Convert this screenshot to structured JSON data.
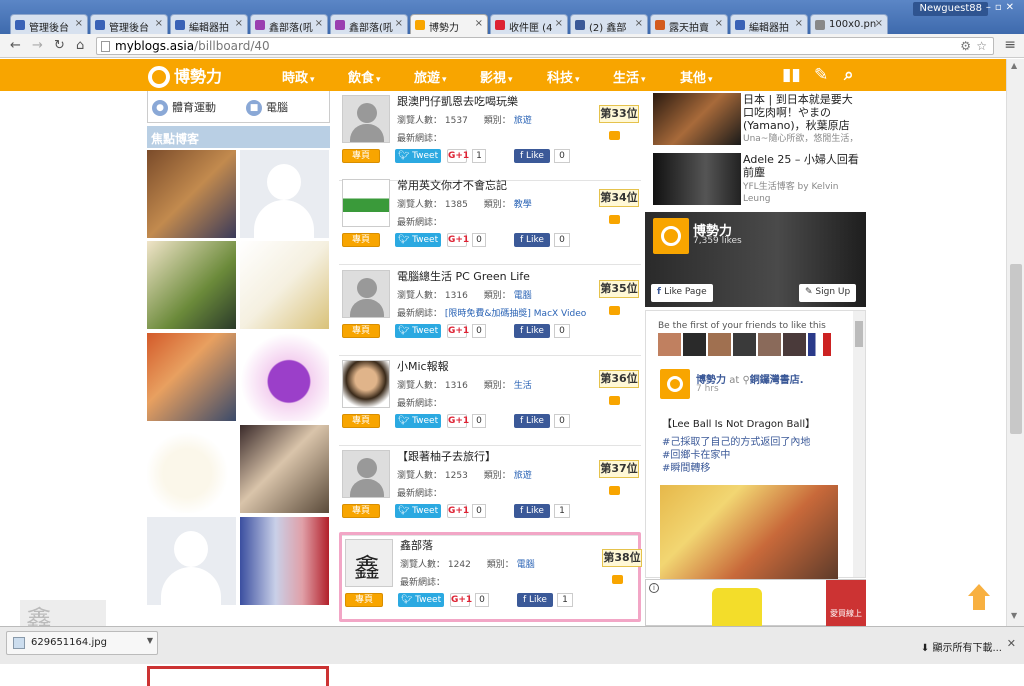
{
  "browser": {
    "tabs": [
      {
        "label": "管理後台",
        "icon_color": "#3a62b7"
      },
      {
        "label": "管理後台",
        "icon_color": "#3a62b7"
      },
      {
        "label": "編輯器拍",
        "icon_color": "#3a62b7"
      },
      {
        "label": "鑫部落(吼",
        "icon_color": "#9a3fb0"
      },
      {
        "label": "鑫部落(吼",
        "icon_color": "#9a3fb0"
      },
      {
        "label": "博勢力",
        "icon_color": "#f8a500"
      },
      {
        "label": "收件匣 (4",
        "icon_color": "#d23"
      },
      {
        "label": "(2) 鑫部",
        "icon_color": "#3b5998"
      },
      {
        "label": "露天拍賣",
        "icon_color": "#d35b1e"
      },
      {
        "label": "編輯器拍",
        "icon_color": "#3a62b7"
      },
      {
        "label": "100x0.pn",
        "icon_color": "#888"
      }
    ],
    "user": "Newguest88",
    "url_host": "myblogs.asia",
    "url_path": "/billboard/40"
  },
  "site": {
    "logo": "博勢力",
    "nav": [
      "時政",
      "飲食",
      "旅遊",
      "影視",
      "科技",
      "生活",
      "其他"
    ],
    "nav_icons": [
      "chart-icon",
      "pencil-icon",
      "search-icon"
    ]
  },
  "left": {
    "cats": [
      "體育運動",
      "電腦"
    ],
    "focus_title": "焦點博客"
  },
  "entries": [
    {
      "title": "跟澳門仔凱恩去吃喝玩樂",
      "views_label": "瀏覽人數：",
      "views": "1537",
      "cat_label": "類別：",
      "cat": "旅遊",
      "latest_label": "最新網誌：",
      "latest": "",
      "rank": "第33位",
      "home": "專頁",
      "tweet": "Tweet",
      "gplus": "G+1",
      "gcount": "1",
      "like": "Like",
      "fcount": "0",
      "thumb": "silhouette"
    },
    {
      "title": "常用英文你才不會忘記",
      "views_label": "瀏覽人數：",
      "views": "1385",
      "cat_label": "類別：",
      "cat": "教學",
      "latest_label": "最新網誌：",
      "latest": "",
      "rank": "第34位",
      "home": "專頁",
      "tweet": "Tweet",
      "gplus": "G+1",
      "gcount": "0",
      "like": "Like",
      "fcount": "0",
      "thumb": "english"
    },
    {
      "title": "電腦總生活 PC Green Life",
      "views_label": "瀏覽人數：",
      "views": "1316",
      "cat_label": "類別：",
      "cat": "電腦",
      "latest_label": "最新網誌：",
      "latest": "[限時免費&加碼抽獎] MacX Video",
      "rank": "第35位",
      "home": "專頁",
      "tweet": "Tweet",
      "gplus": "G+1",
      "gcount": "0",
      "like": "Like",
      "fcount": "0",
      "thumb": "silhouette"
    },
    {
      "title": "小Mic報報",
      "views_label": "瀏覽人數：",
      "views": "1316",
      "cat_label": "類別：",
      "cat": "生活",
      "latest_label": "最新網誌：",
      "latest": "",
      "rank": "第36位",
      "home": "專頁",
      "tweet": "Tweet",
      "gplus": "G+1",
      "gcount": "0",
      "like": "Like",
      "fcount": "0",
      "thumb": "photo"
    },
    {
      "title": "【跟著柚子去旅行】",
      "views_label": "瀏覽人數：",
      "views": "1253",
      "cat_label": "類別：",
      "cat": "旅遊",
      "latest_label": "最新網誌：",
      "latest": "",
      "rank": "第37位",
      "home": "專頁",
      "tweet": "Tweet",
      "gplus": "G+1",
      "gcount": "0",
      "like": "Like",
      "fcount": "1",
      "thumb": "silhouette"
    },
    {
      "title": "鑫部落",
      "views_label": "瀏覽人數：",
      "views": "1242",
      "cat_label": "類別：",
      "cat": "電腦",
      "latest_label": "最新網誌：",
      "latest": "",
      "rank": "第38位",
      "home": "專頁",
      "tweet": "Tweet",
      "gplus": "G+1",
      "gcount": "0",
      "like": "Like",
      "fcount": "1",
      "thumb": "seal"
    }
  ],
  "right": {
    "articles": [
      {
        "title": "日本 | 到日本就是要大口吃肉啊！やまの (Yamano)，秋葉原店",
        "source": "Una~隨心所欲，悠閒生活，"
      },
      {
        "title": "Adele 25 – 小婦人回看前塵",
        "source": "YFL生活博客 by Kelvin Leung"
      }
    ],
    "fb": {
      "name": "博勢力",
      "likes": "7,359 likes",
      "like_page": "Like Page",
      "sign_up": "Sign Up",
      "friends_text": "Be the first of your friends to like this",
      "post_author": "博勢力",
      "post_at": "at",
      "post_place": "銅鑼灣書店.",
      "post_time": "7 hrs",
      "post_line1": "【Lee Ball Is Not Dragon Ball】",
      "post_tags": [
        "#己採取了自己的方式返回了內地",
        "#回鄉卡在家中",
        "#瞬間轉移"
      ]
    },
    "ad_brand": "愛買線上"
  },
  "download": {
    "file": "629651164.jpg",
    "show_all": "顯示所有下載..."
  }
}
